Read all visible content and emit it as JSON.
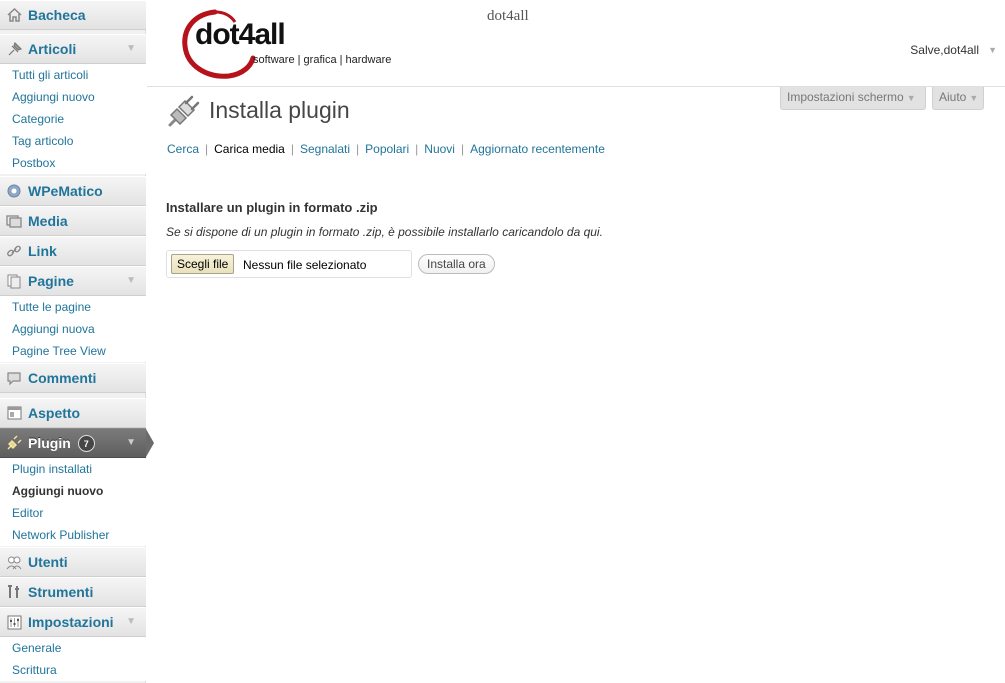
{
  "sidebar": {
    "dashboard": "Bacheca",
    "posts": {
      "label": "Articoli",
      "items": [
        "Tutti gli articoli",
        "Aggiungi nuovo",
        "Categorie",
        "Tag articolo",
        "Postbox"
      ]
    },
    "wpematico": "WPeMatico",
    "media": "Media",
    "links": "Link",
    "pages": {
      "label": "Pagine",
      "items": [
        "Tutte le pagine",
        "Aggiungi nuova",
        "Pagine Tree View"
      ]
    },
    "comments": "Commenti",
    "appearance": "Aspetto",
    "plugins": {
      "label": "Plugin",
      "badge": "7",
      "items": [
        "Plugin installati",
        "Aggiungi nuovo",
        "Editor",
        "Network Publisher"
      ]
    },
    "users": "Utenti",
    "tools": "Strumenti",
    "settings": {
      "label": "Impostazioni",
      "items": [
        "Generale",
        "Scrittura"
      ]
    }
  },
  "header": {
    "logo_text": "dot4all",
    "logo_tagline": "software | grafica | hardware",
    "site_name": "dot4all",
    "greeting": "Salve,dot4all"
  },
  "screen_meta": {
    "screen_options": "Impostazioni schermo",
    "help": "Aiuto"
  },
  "main": {
    "title": "Installa plugin",
    "tabs": [
      "Cerca",
      "Carica media",
      "Segnalati",
      "Popolari",
      "Nuovi",
      "Aggiornato recentemente"
    ],
    "upload_title": "Installare un plugin in formato .zip",
    "upload_desc": "Se si dispone di un plugin in formato .zip, è possibile installarlo caricandolo da qui.",
    "choose_file": "Scegli file",
    "no_file": "Nessun file selezionato",
    "install_now": "Installa ora"
  },
  "colors": {
    "link": "#21759b",
    "logo_red": "#b5121b",
    "sidebar_bg": "#f1f1f1"
  }
}
